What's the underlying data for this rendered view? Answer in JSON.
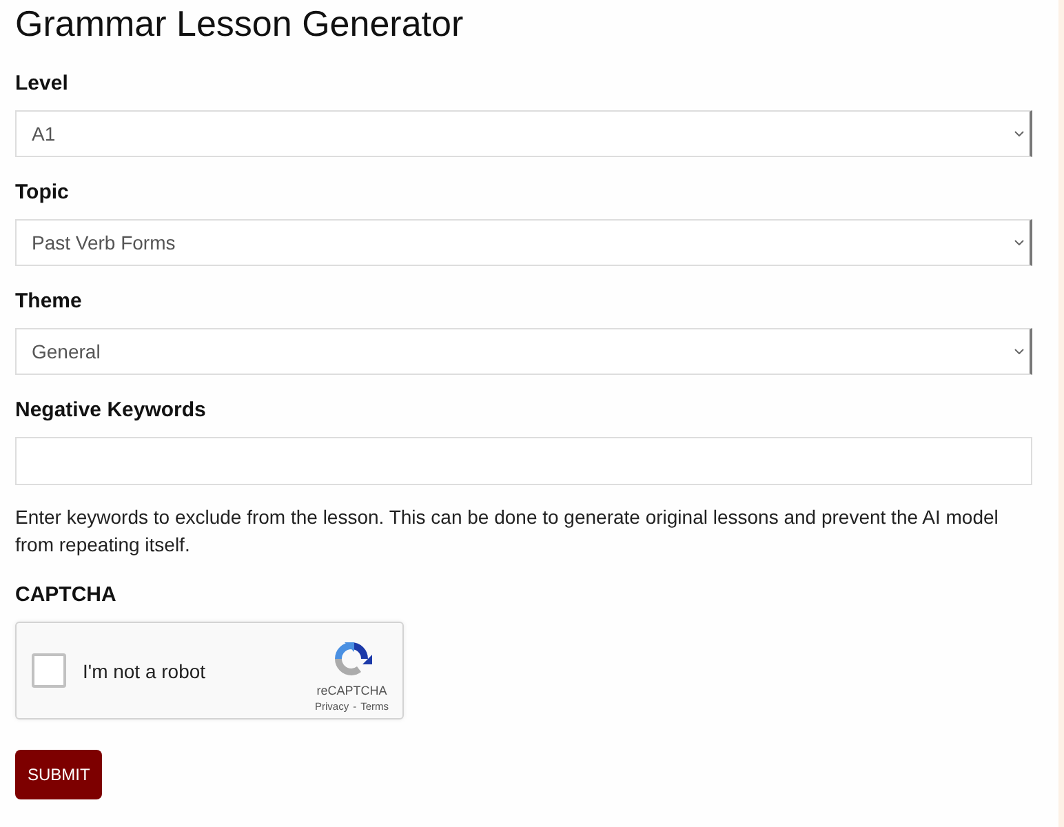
{
  "title": "Grammar Lesson Generator",
  "fields": [
    {
      "kind": "select",
      "label": "Level",
      "value": "A1"
    },
    {
      "kind": "select",
      "label": "Topic",
      "value": "Past Verb Forms"
    },
    {
      "kind": "select",
      "label": "Theme",
      "value": "General"
    },
    {
      "kind": "text",
      "label": "Negative Keywords",
      "help": "Enter keywords to exclude from the lesson. This can be done to generate original lessons and prevent the AI model from repeating itself."
    }
  ],
  "captcha": {
    "label": "CAPTCHA",
    "checkbox_label": "I'm not a robot",
    "checked": false,
    "brand": "reCAPTCHA",
    "links": [
      "Privacy",
      "Terms"
    ],
    "separator": "-"
  },
  "submit": {
    "label": "SUBMIT"
  }
}
